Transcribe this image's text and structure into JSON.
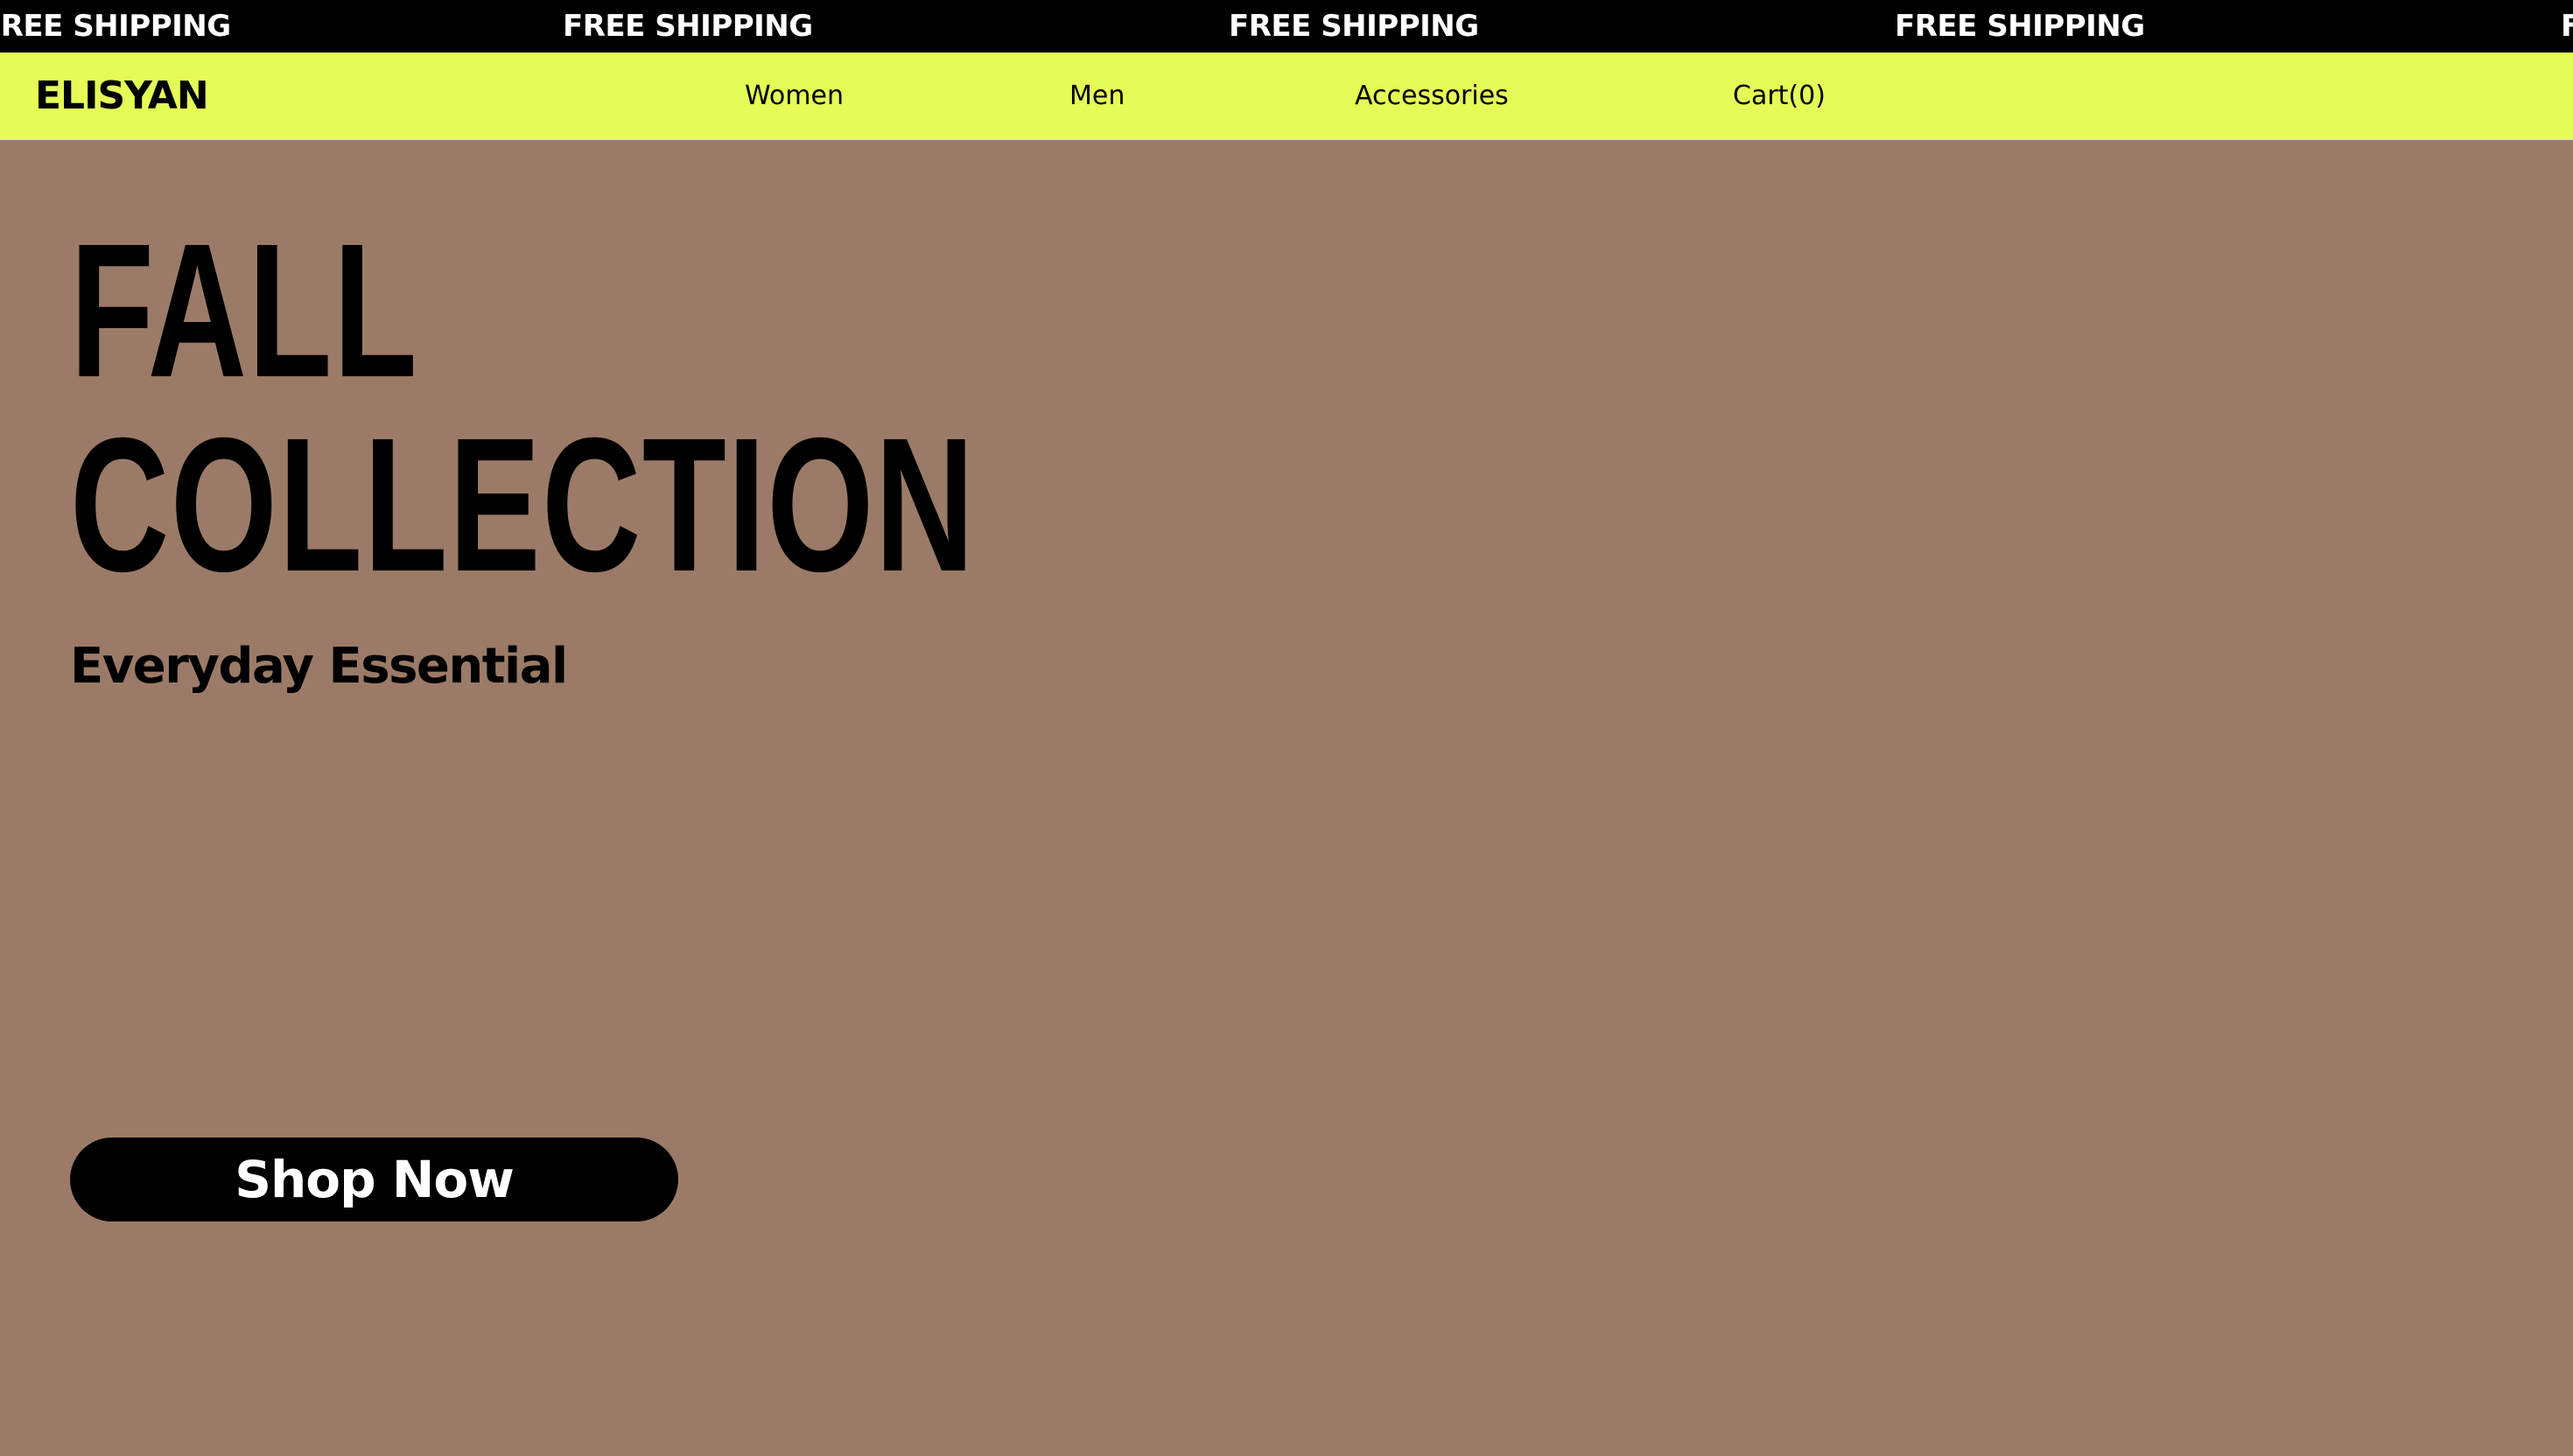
{
  "ticker": {
    "items": [
      "FREE SHIPPING",
      "FREE SHIPPING",
      "FREE SHIPPING",
      "FREE SHIPPING",
      "FREE SHIPPING"
    ]
  },
  "header": {
    "logo": "ELISYAN",
    "nav": {
      "women": "Women",
      "men": "Men",
      "accessories": "Accessories",
      "cart": "Cart(0)"
    }
  },
  "hero": {
    "title_line1": "FALL",
    "title_line2": "COLLECTION",
    "subtitle": "Everyday Essential",
    "cta": "Shop Now"
  },
  "colors": {
    "ticker_bg": "#000000",
    "nav_bg": "#e5fc57",
    "hero_bg": "#9b7b68",
    "button_bg": "#000000",
    "button_text": "#ffffff"
  }
}
